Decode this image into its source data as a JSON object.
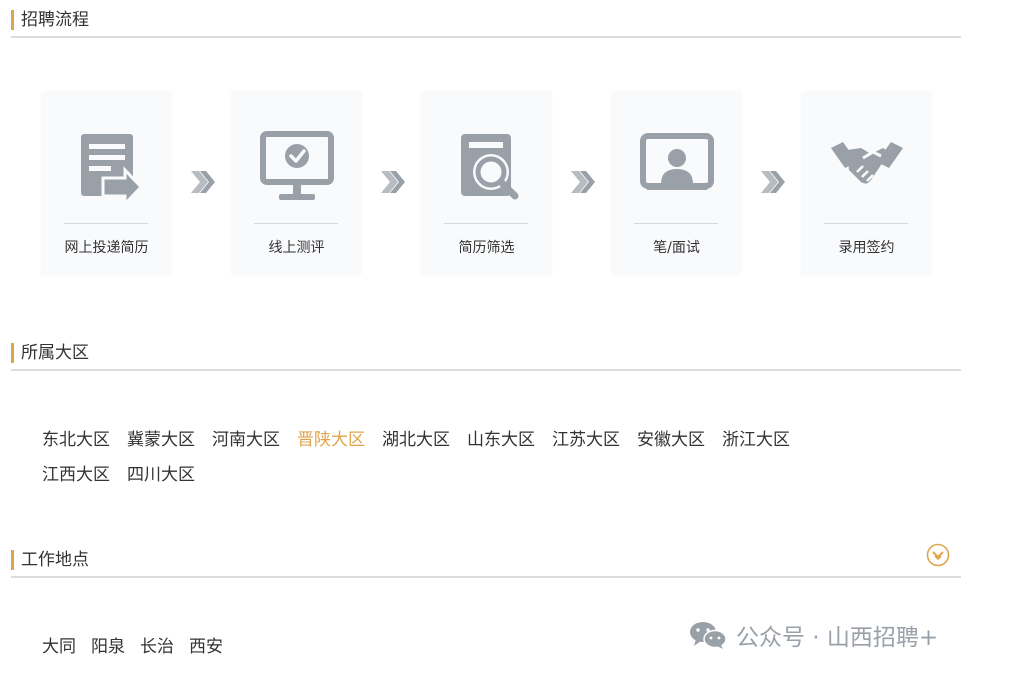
{
  "sections": {
    "process": {
      "title": "招聘流程"
    },
    "region": {
      "title": "所属大区"
    },
    "location": {
      "title": "工作地点"
    }
  },
  "process_steps": [
    {
      "label": "网上投递简历",
      "icon": "resume-submit-icon"
    },
    {
      "label": "线上测评",
      "icon": "monitor-check-icon"
    },
    {
      "label": "简历筛选",
      "icon": "document-search-icon"
    },
    {
      "label": "笔/面试",
      "icon": "interview-screen-icon"
    },
    {
      "label": "录用签约",
      "icon": "handshake-icon"
    }
  ],
  "regions": [
    {
      "label": "东北大区",
      "active": false
    },
    {
      "label": "冀蒙大区",
      "active": false
    },
    {
      "label": "河南大区",
      "active": false
    },
    {
      "label": "晋陕大区",
      "active": true
    },
    {
      "label": "湖北大区",
      "active": false
    },
    {
      "label": "山东大区",
      "active": false
    },
    {
      "label": "江苏大区",
      "active": false
    },
    {
      "label": "安徽大区",
      "active": false
    },
    {
      "label": "浙江大区",
      "active": false
    },
    {
      "label": "江西大区",
      "active": false
    },
    {
      "label": "四川大区",
      "active": false
    }
  ],
  "locations": [
    {
      "label": "大同"
    },
    {
      "label": "阳泉"
    },
    {
      "label": "长治"
    },
    {
      "label": "西安"
    }
  ],
  "collapse_toggle_icon": "chevron-down-circle-icon",
  "watermark": {
    "text": "公众号 · 山西招聘+",
    "icon": "wechat-icon"
  },
  "colors": {
    "accent": "#e0a54c",
    "icon_gray": "#9aa0a8",
    "text": "#333333",
    "divider": "#dcdcdc",
    "card_bg": "#f9fafc"
  }
}
